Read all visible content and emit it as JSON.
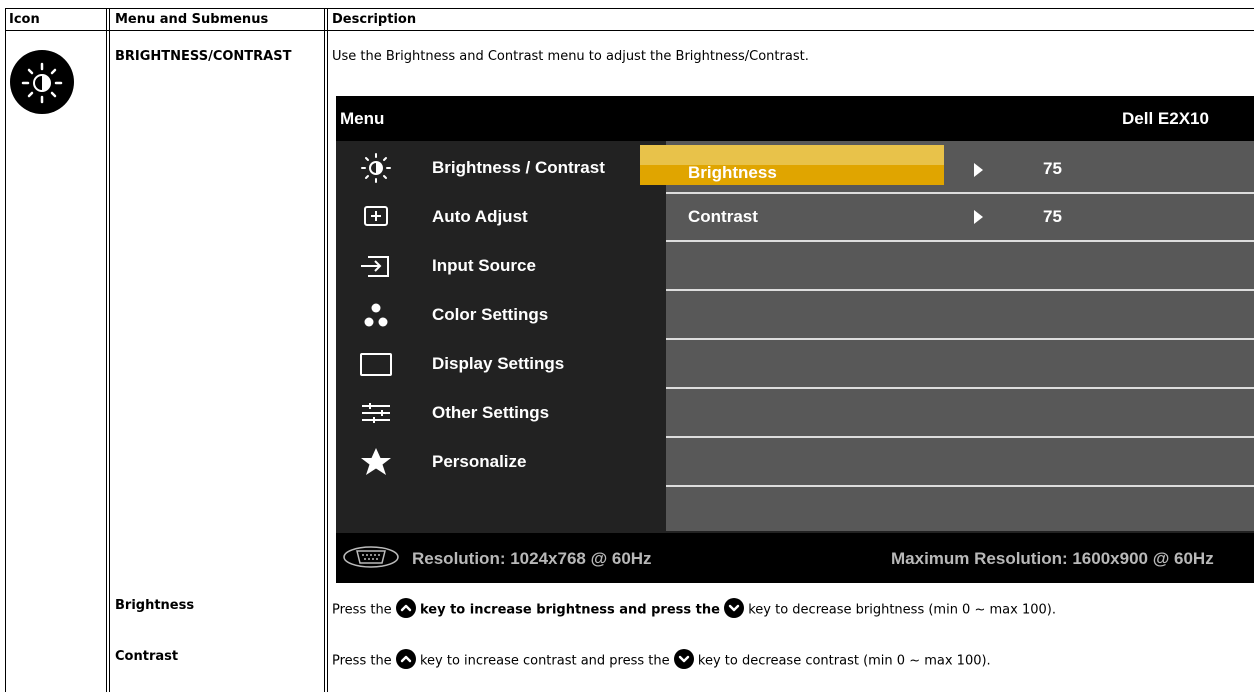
{
  "table": {
    "headers": {
      "icon": "Icon",
      "menu": "Menu and Submenus",
      "description": "Description"
    }
  },
  "rows": {
    "brightness_contrast": {
      "name": "BRIGHTNESS/CONTRAST",
      "description": "Use the Brightness and Contrast menu to adjust the Brightness/Contrast."
    },
    "brightness": {
      "name": "Brightness",
      "desc_part1": "Press the",
      "desc_part2": " key to increase brightness and press the",
      "desc_part3": "key to decrease brightness (min 0 ~ max 100)."
    },
    "contrast": {
      "name": "Contrast",
      "desc_part1": "Press the",
      "desc_part2": "key to increase contrast and press the",
      "desc_part3": "key to decrease contrast (min 0 ~ max 100)."
    }
  },
  "osd": {
    "title": "Menu",
    "model": "Dell E2X10",
    "menu_items": [
      {
        "label": "Brightness / Contrast",
        "icon": "brightness-icon"
      },
      {
        "label": "Auto Adjust",
        "icon": "auto-adjust-icon"
      },
      {
        "label": "Input Source",
        "icon": "input-source-icon"
      },
      {
        "label": "Color Settings",
        "icon": "color-settings-icon"
      },
      {
        "label": "Display Settings",
        "icon": "display-settings-icon"
      },
      {
        "label": "Other Settings",
        "icon": "other-settings-icon"
      },
      {
        "label": "Personalize",
        "icon": "star-icon"
      }
    ],
    "submenu": [
      {
        "label": "Brightness",
        "value": "75"
      },
      {
        "label": "Contrast",
        "value": "75"
      }
    ],
    "resolution": "Resolution: 1024x768 @ 60Hz",
    "max_resolution": "Maximum Resolution: 1600x900 @ 60Hz",
    "colors": {
      "selected_top": "#e8c24a",
      "selected_bottom": "#e0a500",
      "panel": "#585858",
      "menu_bg": "#222222"
    }
  }
}
